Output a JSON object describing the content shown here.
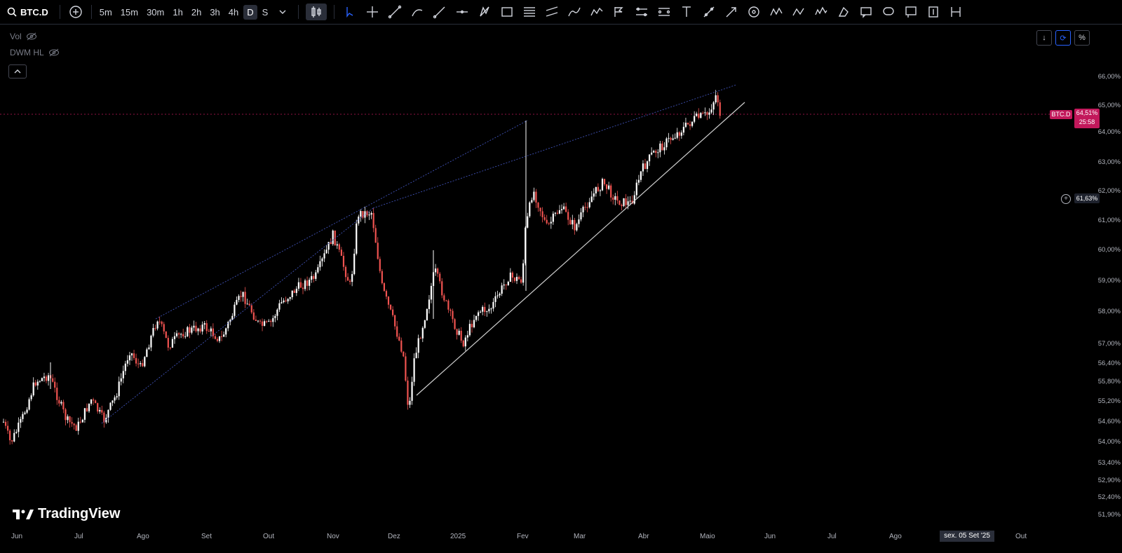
{
  "header": {
    "symbol": "BTC.D",
    "timeframes": [
      "5m",
      "15m",
      "30m",
      "1h",
      "2h",
      "3h",
      "4h",
      "D",
      "S"
    ],
    "active_timeframe": "D",
    "tool_icons": [
      "cursor-icon",
      "crosshair-icon",
      "trendline-icon",
      "brush-icon",
      "ray-icon",
      "horizontal-line-icon",
      "pattern-icon",
      "rectangle-icon",
      "fib-icon",
      "channel-icon",
      "path-icon",
      "zigzag-icon",
      "pitchfork-icon",
      "projection-icon",
      "position-icon",
      "text-icon",
      "measure-icon",
      "arrow-icon",
      "target-icon",
      "xabcd-icon",
      "abcd-icon",
      "elliott-icon",
      "eraser-icon",
      "comment-icon",
      "callout-icon",
      "flag-icon",
      "price-label-icon",
      "range-icon"
    ]
  },
  "overlays": {
    "vol_label": "Vol",
    "dwm_label": "DWM HL"
  },
  "price_scale": {
    "labels": [
      "66,00%",
      "65,00%",
      "64,00%",
      "63,00%",
      "62,00%",
      "61,00%",
      "60,00%",
      "59,00%",
      "58,00%",
      "57,00%",
      "56,40%",
      "55,80%",
      "55,20%",
      "54,60%",
      "54,00%",
      "53,40%",
      "52,90%",
      "52,40%",
      "51,90%"
    ],
    "unit_button": "%"
  },
  "current_price": {
    "symbol_tag": "BTC.D",
    "value": "64,51%",
    "countdown": "25:58",
    "color": "#c2185b"
  },
  "crosshair_price": "61,63%",
  "time_axis": {
    "labels": [
      "Jun",
      "Jul",
      "Ago",
      "Set",
      "Out",
      "Nov",
      "Dez",
      "2025",
      "Fev",
      "Mar",
      "Abr",
      "Maio",
      "Jun",
      "Jul",
      "Ago",
      "Out"
    ],
    "crosshair_date": "sex. 05 Set '25"
  },
  "branding": {
    "logo_text": "TradingView"
  },
  "colors": {
    "up": "#ffffff",
    "down": "#ef5350",
    "channel": "#3f51b5",
    "trendline": "#cfcfcf"
  },
  "chart_data": {
    "type": "candlestick",
    "title": "BTC.D",
    "x_range": [
      "2024-06",
      "2025-10"
    ],
    "ylim": [
      51.9,
      66.0
    ],
    "y_scale": "log",
    "approx_closes": [
      {
        "x": "2024-06",
        "y": 54.6
      },
      {
        "x": "2024-07",
        "y": 55.0
      },
      {
        "x": "2024-08",
        "y": 56.8
      },
      {
        "x": "2024-09",
        "y": 57.3
      },
      {
        "x": "2024-10",
        "y": 57.8
      },
      {
        "x": "2024-11",
        "y": 60.5
      },
      {
        "x": "2024-12",
        "y": 54.9
      },
      {
        "x": "2025-01",
        "y": 58.0
      },
      {
        "x": "2025-02",
        "y": 61.0
      },
      {
        "x": "2025-03",
        "y": 61.5
      },
      {
        "x": "2025-04",
        "y": 63.4
      },
      {
        "x": "2025-05",
        "y": 64.51
      }
    ]
  }
}
